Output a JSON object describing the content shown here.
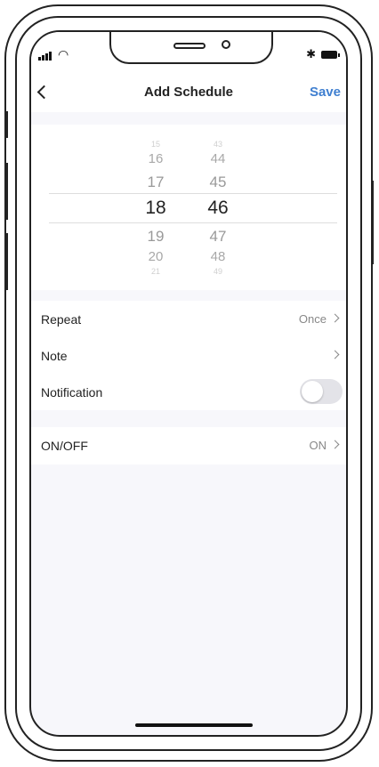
{
  "navbar": {
    "title": "Add Schedule",
    "save_label": "Save"
  },
  "picker": {
    "hours": [
      "15",
      "16",
      "17",
      "18",
      "19",
      "20",
      "21"
    ],
    "minutes": [
      "43",
      "44",
      "45",
      "46",
      "47",
      "48",
      "49"
    ],
    "selected_hour": "18",
    "selected_minute": "46"
  },
  "settings": {
    "repeat": {
      "label": "Repeat",
      "value": "Once"
    },
    "note": {
      "label": "Note",
      "value": ""
    },
    "notification": {
      "label": "Notification",
      "enabled": false
    },
    "onoff": {
      "label": "ON/OFF",
      "value": "ON"
    }
  },
  "colors": {
    "accent": "#3f7fd0",
    "background": "#f7f7fb",
    "toggle_off": "#e3e3e8"
  }
}
